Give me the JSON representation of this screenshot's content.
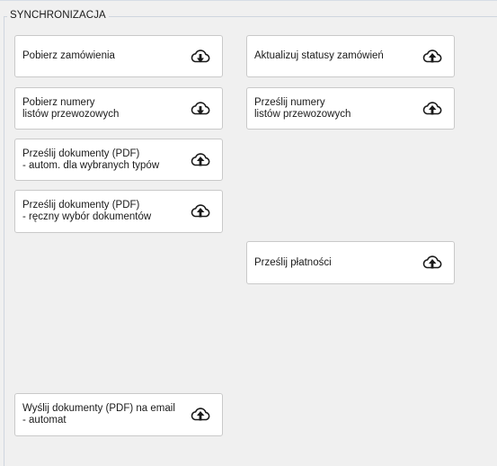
{
  "group": {
    "title": "SYNCHRONIZACJA"
  },
  "buttons": {
    "get_orders": {
      "label": "Pobierz zamówienia",
      "icon": "cloud-download-icon"
    },
    "get_waybills": {
      "label": "Pobierz numery\nlistów przewozowych",
      "icon": "cloud-download-icon"
    },
    "send_docs_auto": {
      "label": "Prześlij dokumenty (PDF)\n- autom. dla wybranych typów",
      "icon": "cloud-upload-icon"
    },
    "send_docs_manual": {
      "label": "Prześlij dokumenty (PDF)\n- ręczny wybór dokumentów",
      "icon": "cloud-upload-icon"
    },
    "email_docs_auto": {
      "label": "Wyślij dokumenty (PDF) na email\n- automat",
      "icon": "cloud-upload-icon"
    },
    "update_statuses": {
      "label": "Aktualizuj statusy zamówień",
      "icon": "cloud-upload-icon"
    },
    "send_waybills": {
      "label": "Prześlij numery\nlistów przewozowych",
      "icon": "cloud-upload-icon"
    },
    "send_payments": {
      "label": "Prześlij płatności",
      "icon": "cloud-upload-icon"
    }
  }
}
